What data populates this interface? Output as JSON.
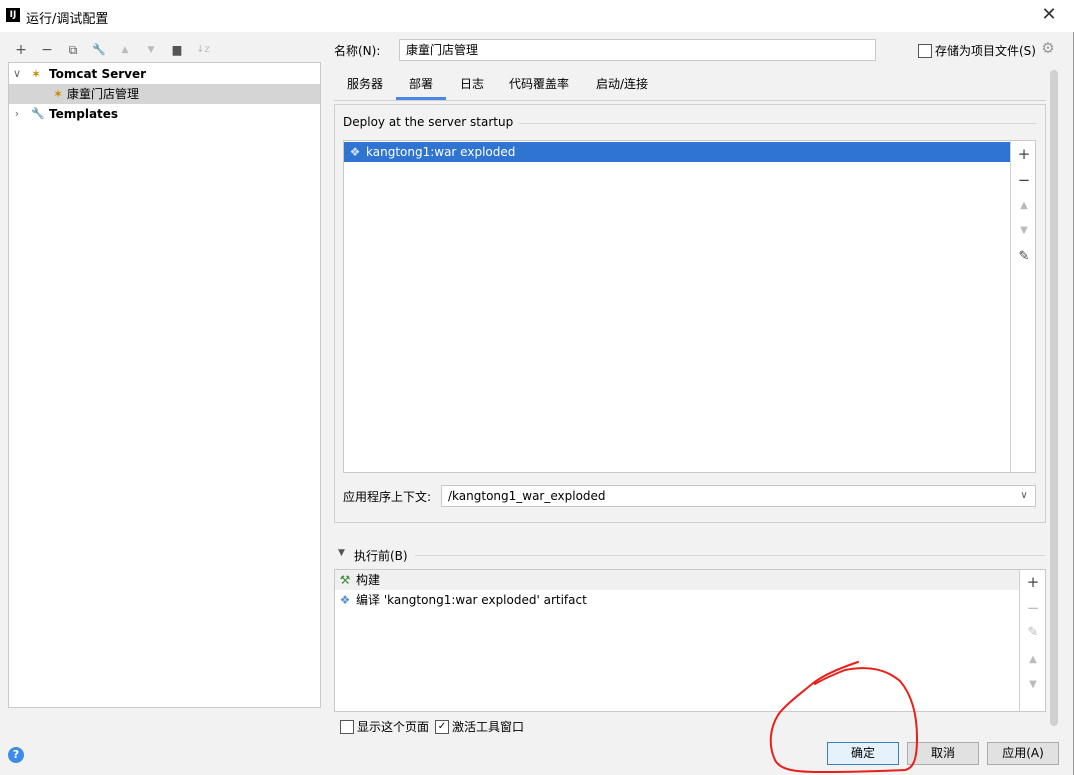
{
  "window": {
    "title": "运行/调试配置",
    "app_icon": "IJ",
    "close_label": "✕"
  },
  "toolbar": {
    "items": [
      {
        "name": "add-icon",
        "glyph": "+"
      },
      {
        "name": "remove-icon",
        "glyph": "−"
      },
      {
        "name": "copy-icon",
        "glyph": "⧉"
      },
      {
        "name": "wrench-icon",
        "glyph": "🔧"
      },
      {
        "name": "move-up-icon",
        "glyph": "▲"
      },
      {
        "name": "move-down-icon",
        "glyph": "▼"
      },
      {
        "name": "folder-add-icon",
        "glyph": "▆"
      },
      {
        "name": "sort-icon",
        "glyph": "↓z"
      }
    ]
  },
  "tree": {
    "items": [
      {
        "label": "Tomcat Server",
        "icon": "tomcat-icon",
        "glyph": "🐱"
      },
      {
        "label": "康童门店管理",
        "icon": "tomcat-icon",
        "glyph": "🐱"
      },
      {
        "label": "Templates",
        "icon": "wrench-icon",
        "glyph": "🔧"
      }
    ]
  },
  "help_label": "?",
  "config": {
    "name_label": "名称(N):",
    "name_value": "康童门店管理",
    "store_as_file_label": "存储为项目文件(S)",
    "gear_glyph": "⚙"
  },
  "tabs": [
    {
      "label": "服务器"
    },
    {
      "label": "部署"
    },
    {
      "label": "日志"
    },
    {
      "label": "代码覆盖率"
    },
    {
      "label": "启动/连接"
    }
  ],
  "deploy": {
    "title": "Deploy at the server startup",
    "items": [
      {
        "label": "kangtong1:war exploded",
        "icon": "artifact-icon",
        "glyph": "❖"
      }
    ],
    "side_buttons": [
      {
        "name": "add-icon",
        "glyph": "+"
      },
      {
        "name": "remove-icon",
        "glyph": "−"
      },
      {
        "name": "move-up-icon",
        "glyph": "▲"
      },
      {
        "name": "move-down-icon",
        "glyph": "▼"
      },
      {
        "name": "edit-icon",
        "glyph": "✎"
      }
    ],
    "context_label": "应用程序上下文:",
    "context_value": "/kangtong1_war_exploded",
    "dropdown_glyph": "∨"
  },
  "before_launch": {
    "title": "执行前(B)",
    "items": [
      {
        "label": "构建",
        "icon": "build-hammer-icon",
        "glyph": "⚒"
      },
      {
        "label": "编译 'kangtong1:war exploded' artifact",
        "icon": "artifact-icon",
        "glyph": "❖"
      }
    ],
    "side_buttons": [
      {
        "name": "add-icon",
        "glyph": "+"
      },
      {
        "name": "remove-icon",
        "glyph": "−"
      },
      {
        "name": "edit-icon",
        "glyph": "✎"
      },
      {
        "name": "move-up-icon",
        "glyph": "▲"
      },
      {
        "name": "move-down-icon",
        "glyph": "▼"
      }
    ],
    "show_page_label": "显示这个页面",
    "show_page_checked": false,
    "activate_window_label": "激活工具窗口",
    "activate_window_checked": true
  },
  "buttons": {
    "ok": "确定",
    "cancel": "取消",
    "apply": "应用(A)"
  },
  "colors": {
    "selection": "#2f74d0",
    "tab_indicator": "#4a86e8",
    "annotation": "#e8201a"
  }
}
